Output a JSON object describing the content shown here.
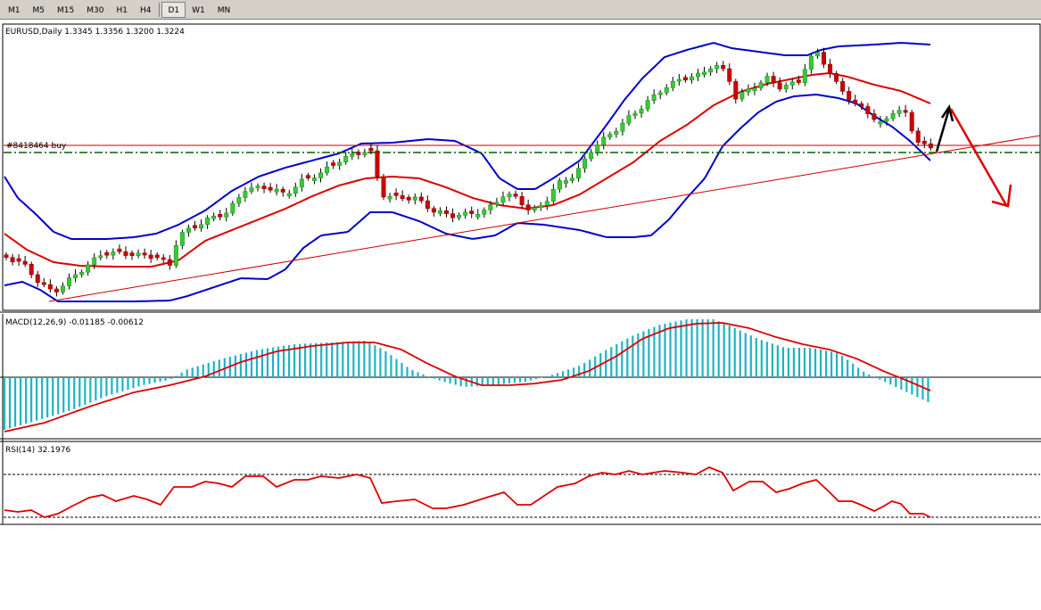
{
  "toolbar": {
    "timeframes": [
      "M1",
      "M5",
      "M15",
      "M30",
      "H1",
      "H4",
      "D1",
      "W1",
      "MN"
    ],
    "active": "D1"
  },
  "colors": {
    "bull_candle": "#32cd32",
    "bear_candle": "#cc0000",
    "bollinger": "#0000cc",
    "bollinger_mid": "#dd0000",
    "macd_hist": "#20b2c4",
    "macd_signal": "#dd0000",
    "rsi_line": "#dd0000",
    "trendline": "#cc0000",
    "order_line": "#cc0000",
    "level_line": "#006400",
    "arrow_up": "#000000",
    "arrow_down": "#dd0000"
  },
  "chart_data": [
    {
      "type": "candlestick",
      "title": "EURUSD,Daily  1.3345 1.3356 1.3200 1.3224",
      "order_label": "#8418464 buy",
      "series": [
        {
          "name": "Bollinger Bands"
        },
        {
          "name": "Trendline"
        }
      ]
    },
    {
      "type": "bar",
      "title": "MACD(12,26,9) -0.01185 -0.00612",
      "series": [
        {
          "name": "MACD histogram"
        },
        {
          "name": "Signal"
        }
      ]
    },
    {
      "type": "line",
      "title": "RSI(14) 32.1976",
      "ylim": [
        0,
        100
      ],
      "levels": [
        30,
        70
      ]
    }
  ]
}
